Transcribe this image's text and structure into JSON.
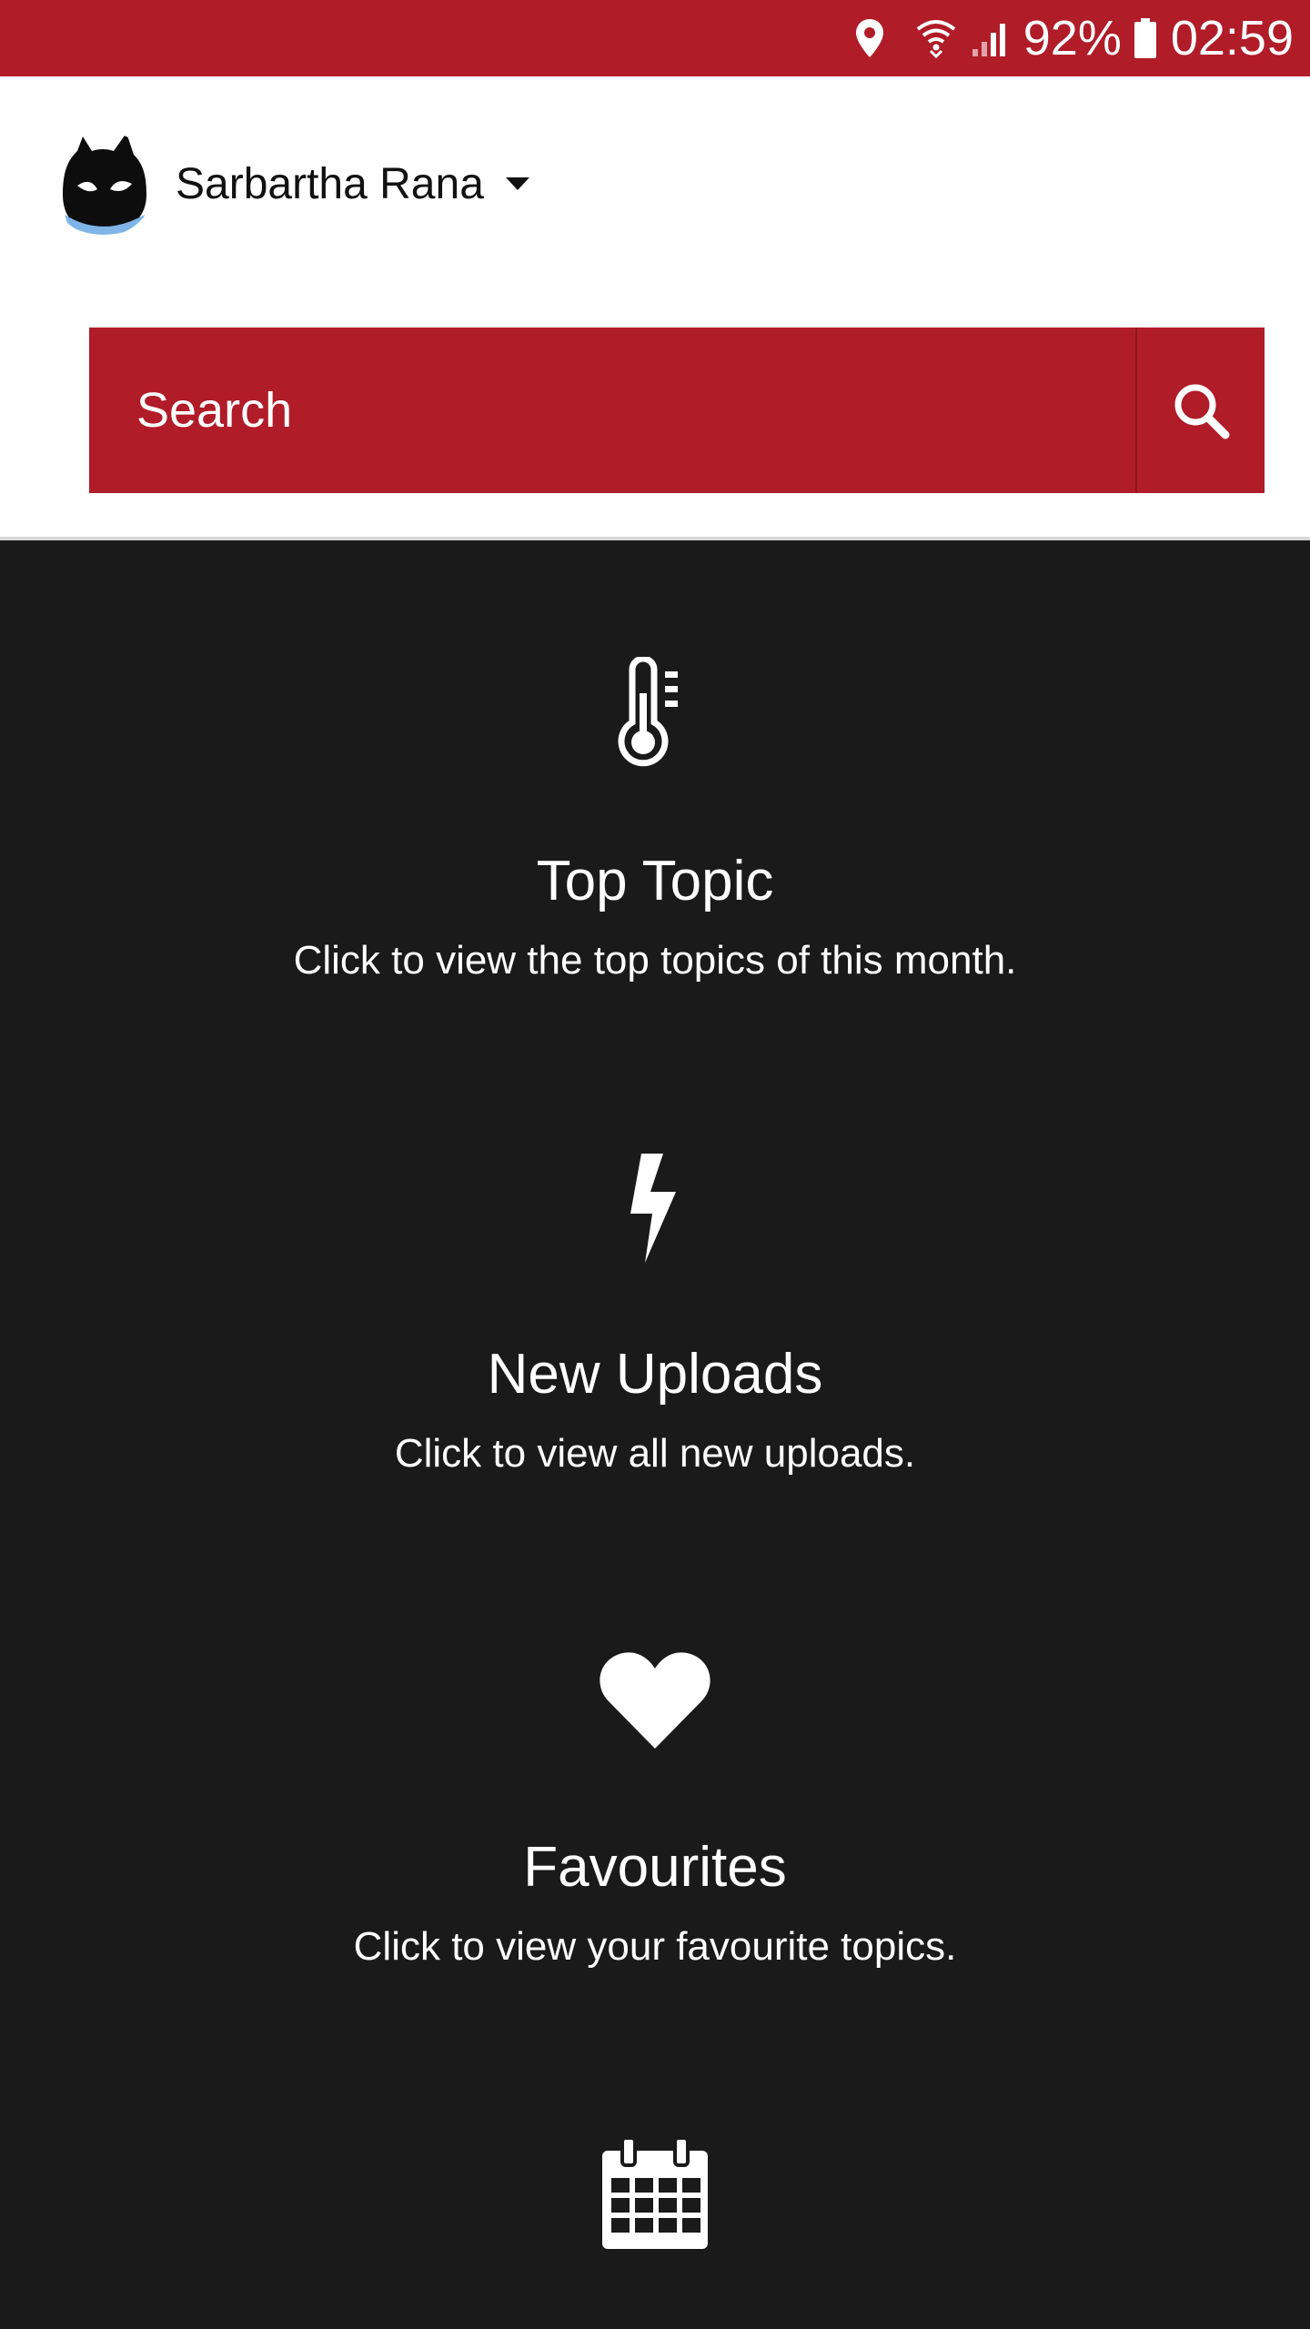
{
  "status_bar": {
    "battery": "92%",
    "time": "02:59",
    "icons": [
      "location-icon",
      "wifi-icon",
      "signal-icon",
      "battery-icon"
    ]
  },
  "header": {
    "username": "Sarbartha Rana"
  },
  "search": {
    "placeholder": "Search"
  },
  "cards": [
    {
      "icon": "thermometer-icon",
      "title": "Top Topic",
      "description": "Click to view the top topics of this month."
    },
    {
      "icon": "lightning-icon",
      "title": "New Uploads",
      "description": "Click to view all new uploads."
    },
    {
      "icon": "heart-icon",
      "title": "Favourites",
      "description": "Click to view your favourite topics."
    },
    {
      "icon": "calendar-icon",
      "title": "",
      "description": ""
    }
  ],
  "colors": {
    "brand_red": "#b01c28",
    "background_dark": "#1a1a1a",
    "header_white": "#ffffff"
  }
}
